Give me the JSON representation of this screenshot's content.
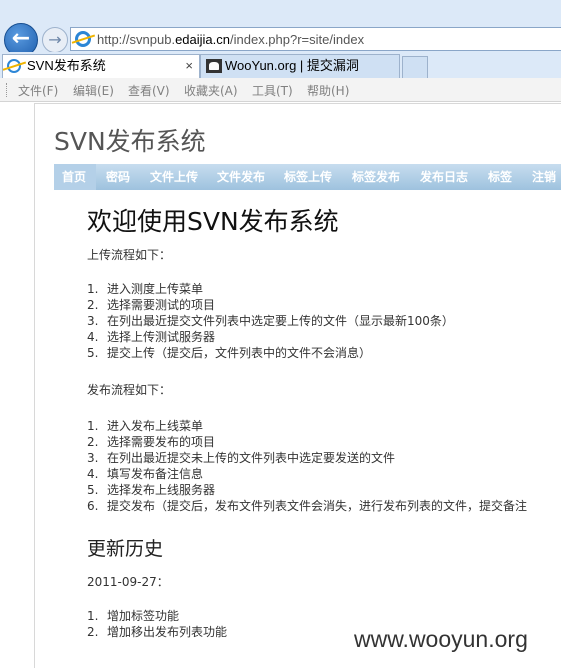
{
  "browser": {
    "url_prefix": "http://svnpub.",
    "url_domain": "edaijia.cn",
    "url_suffix": "/index.php?r=site/index",
    "back_glyph": "←",
    "forward_glyph": "→",
    "tabs": [
      {
        "label": "SVN发布系统",
        "close": "×"
      },
      {
        "label": "WooYun.org | 提交漏洞"
      }
    ],
    "menu": [
      "文件(F)",
      "编辑(E)",
      "查看(V)",
      "收藏夹(A)",
      "工具(T)",
      "帮助(H)"
    ]
  },
  "site": {
    "title": "SVN发布系统",
    "nav": [
      "首页",
      "密码",
      "文件上传",
      "文件发布",
      "标签上传",
      "标签发布",
      "发布日志",
      "标签",
      "注销 ("
    ]
  },
  "main": {
    "heading": "欢迎使用SVN发布系统",
    "upload_intro": "上传流程如下：",
    "upload_steps": [
      {
        "num": "1.",
        "text": "进入测度上传菜单"
      },
      {
        "num": "2.",
        "text": "选择需要测试的项目"
      },
      {
        "num": "3.",
        "text": "在列出最近提交文件列表中选定要上传的文件（显示最新100条）"
      },
      {
        "num": "4.",
        "text": "选择上传测试服务器"
      },
      {
        "num": "5.",
        "text": "提交上传（提交后，文件列表中的文件不会消息）"
      }
    ],
    "publish_intro": "发布流程如下：",
    "publish_steps": [
      {
        "num": "1.",
        "text": "进入发布上线菜单"
      },
      {
        "num": "2.",
        "text": "选择需要发布的项目"
      },
      {
        "num": "3.",
        "text": "在列出最近提交未上传的文件列表中选定要发送的文件"
      },
      {
        "num": "4.",
        "text": "填写发布备注信息"
      },
      {
        "num": "5.",
        "text": "选择发布上线服务器"
      },
      {
        "num": "6.",
        "text": "提交发布（提交后，发布文件列表文件会消失，进行发布列表的文件，提交备注"
      }
    ],
    "history_heading": "更新历史",
    "history_date": "2011-09-27：",
    "history_items": [
      {
        "num": "1.",
        "text": "增加标签功能"
      },
      {
        "num": "2.",
        "text": "增加移出发布列表功能"
      }
    ]
  },
  "watermark": "www.wooyun.org"
}
